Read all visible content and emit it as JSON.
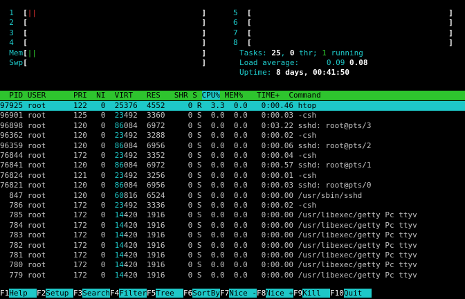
{
  "meters": {
    "cpus": [
      "1",
      "2",
      "3",
      "4",
      "5",
      "6",
      "7",
      "8"
    ],
    "mem_label": "Mem",
    "swp_label": "Swp"
  },
  "tasks": {
    "label": "Tasks: ",
    "count": "25",
    "sep": ", ",
    "thr": "0",
    "thr_label": " thr; ",
    "running": "1",
    "running_label": " running"
  },
  "load": {
    "label": "Load average: ",
    "v1": "0.09",
    "v2": "0.08"
  },
  "uptime": {
    "label": "Uptime: ",
    "value": "8 days, 00:41:50"
  },
  "columns": [
    "PID",
    "USER",
    "PRI",
    "NI",
    "VIRT",
    "RES",
    "SHR",
    "S",
    "CPU%",
    "MEM%",
    "TIME+",
    "Command"
  ],
  "processes": [
    {
      "pid": "97925",
      "user": "root",
      "pri": "122",
      "ni": "0",
      "virt": "25376",
      "res": "4552",
      "shr": "0",
      "s": "R",
      "cpu": "3.3",
      "mem": "0.0",
      "time": "0:00.46",
      "cmd": "htop"
    },
    {
      "pid": "96901",
      "user": "root",
      "pri": "125",
      "ni": "0",
      "virt": "23492",
      "res": "3360",
      "shr": "0",
      "s": "S",
      "cpu": "0.0",
      "mem": "0.0",
      "time": "0:00.03",
      "cmd": "-csh"
    },
    {
      "pid": "96898",
      "user": "root",
      "pri": "120",
      "ni": "0",
      "virt": "86084",
      "res": "6972",
      "shr": "0",
      "s": "S",
      "cpu": "0.0",
      "mem": "0.0",
      "time": "0:03.22",
      "cmd": "sshd: root@pts/3"
    },
    {
      "pid": "96362",
      "user": "root",
      "pri": "120",
      "ni": "0",
      "virt": "23492",
      "res": "3288",
      "shr": "0",
      "s": "S",
      "cpu": "0.0",
      "mem": "0.0",
      "time": "0:00.02",
      "cmd": "-csh"
    },
    {
      "pid": "96359",
      "user": "root",
      "pri": "120",
      "ni": "0",
      "virt": "86084",
      "res": "6956",
      "shr": "0",
      "s": "S",
      "cpu": "0.0",
      "mem": "0.0",
      "time": "0:00.06",
      "cmd": "sshd: root@pts/2"
    },
    {
      "pid": "76844",
      "user": "root",
      "pri": "172",
      "ni": "0",
      "virt": "23492",
      "res": "3352",
      "shr": "0",
      "s": "S",
      "cpu": "0.0",
      "mem": "0.0",
      "time": "0:00.04",
      "cmd": "-csh"
    },
    {
      "pid": "76841",
      "user": "root",
      "pri": "120",
      "ni": "0",
      "virt": "86084",
      "res": "6972",
      "shr": "0",
      "s": "S",
      "cpu": "0.0",
      "mem": "0.0",
      "time": "0:00.57",
      "cmd": "sshd: root@pts/1"
    },
    {
      "pid": "76824",
      "user": "root",
      "pri": "121",
      "ni": "0",
      "virt": "23492",
      "res": "3256",
      "shr": "0",
      "s": "S",
      "cpu": "0.0",
      "mem": "0.0",
      "time": "0:00.01",
      "cmd": "-csh"
    },
    {
      "pid": "76821",
      "user": "root",
      "pri": "120",
      "ni": "0",
      "virt": "86084",
      "res": "6956",
      "shr": "0",
      "s": "S",
      "cpu": "0.0",
      "mem": "0.0",
      "time": "0:00.03",
      "cmd": "sshd: root@pts/0"
    },
    {
      "pid": "847",
      "user": "root",
      "pri": "120",
      "ni": "0",
      "virt": "60816",
      "res": "6524",
      "shr": "0",
      "s": "S",
      "cpu": "0.0",
      "mem": "0.0",
      "time": "0:00.00",
      "cmd": "/usr/sbin/sshd"
    },
    {
      "pid": "786",
      "user": "root",
      "pri": "172",
      "ni": "0",
      "virt": "23492",
      "res": "3336",
      "shr": "0",
      "s": "S",
      "cpu": "0.0",
      "mem": "0.0",
      "time": "0:00.02",
      "cmd": "-csh"
    },
    {
      "pid": "785",
      "user": "root",
      "pri": "172",
      "ni": "0",
      "virt": "14420",
      "res": "1916",
      "shr": "0",
      "s": "S",
      "cpu": "0.0",
      "mem": "0.0",
      "time": "0:00.00",
      "cmd": "/usr/libexec/getty Pc ttyv"
    },
    {
      "pid": "784",
      "user": "root",
      "pri": "172",
      "ni": "0",
      "virt": "14420",
      "res": "1916",
      "shr": "0",
      "s": "S",
      "cpu": "0.0",
      "mem": "0.0",
      "time": "0:00.00",
      "cmd": "/usr/libexec/getty Pc ttyv"
    },
    {
      "pid": "783",
      "user": "root",
      "pri": "172",
      "ni": "0",
      "virt": "14420",
      "res": "1916",
      "shr": "0",
      "s": "S",
      "cpu": "0.0",
      "mem": "0.0",
      "time": "0:00.00",
      "cmd": "/usr/libexec/getty Pc ttyv"
    },
    {
      "pid": "782",
      "user": "root",
      "pri": "172",
      "ni": "0",
      "virt": "14420",
      "res": "1916",
      "shr": "0",
      "s": "S",
      "cpu": "0.0",
      "mem": "0.0",
      "time": "0:00.00",
      "cmd": "/usr/libexec/getty Pc ttyv"
    },
    {
      "pid": "781",
      "user": "root",
      "pri": "172",
      "ni": "0",
      "virt": "14420",
      "res": "1916",
      "shr": "0",
      "s": "S",
      "cpu": "0.0",
      "mem": "0.0",
      "time": "0:00.00",
      "cmd": "/usr/libexec/getty Pc ttyv"
    },
    {
      "pid": "780",
      "user": "root",
      "pri": "172",
      "ni": "0",
      "virt": "14420",
      "res": "1916",
      "shr": "0",
      "s": "S",
      "cpu": "0.0",
      "mem": "0.0",
      "time": "0:00.00",
      "cmd": "/usr/libexec/getty Pc ttyv"
    },
    {
      "pid": "779",
      "user": "root",
      "pri": "172",
      "ni": "0",
      "virt": "14420",
      "res": "1916",
      "shr": "0",
      "s": "S",
      "cpu": "0.0",
      "mem": "0.0",
      "time": "0:00.00",
      "cmd": "/usr/libexec/getty Pc ttyv"
    }
  ],
  "footer": [
    {
      "key": "F1",
      "label": "Help"
    },
    {
      "key": "F2",
      "label": "Setup"
    },
    {
      "key": "F3",
      "label": "Search"
    },
    {
      "key": "F4",
      "label": "Filter"
    },
    {
      "key": "F5",
      "label": "Tree"
    },
    {
      "key": "F6",
      "label": "SortBy"
    },
    {
      "key": "F7",
      "label": "Nice -"
    },
    {
      "key": "F8",
      "label": "Nice +"
    },
    {
      "key": "F9",
      "label": "Kill"
    },
    {
      "key": "F10",
      "label": "Quit"
    }
  ],
  "colors": {
    "header_bg": "#2ec42e",
    "selected_bg": "#1ec8c8",
    "accent": "#1ec8c8",
    "green": "#2fd02f"
  }
}
